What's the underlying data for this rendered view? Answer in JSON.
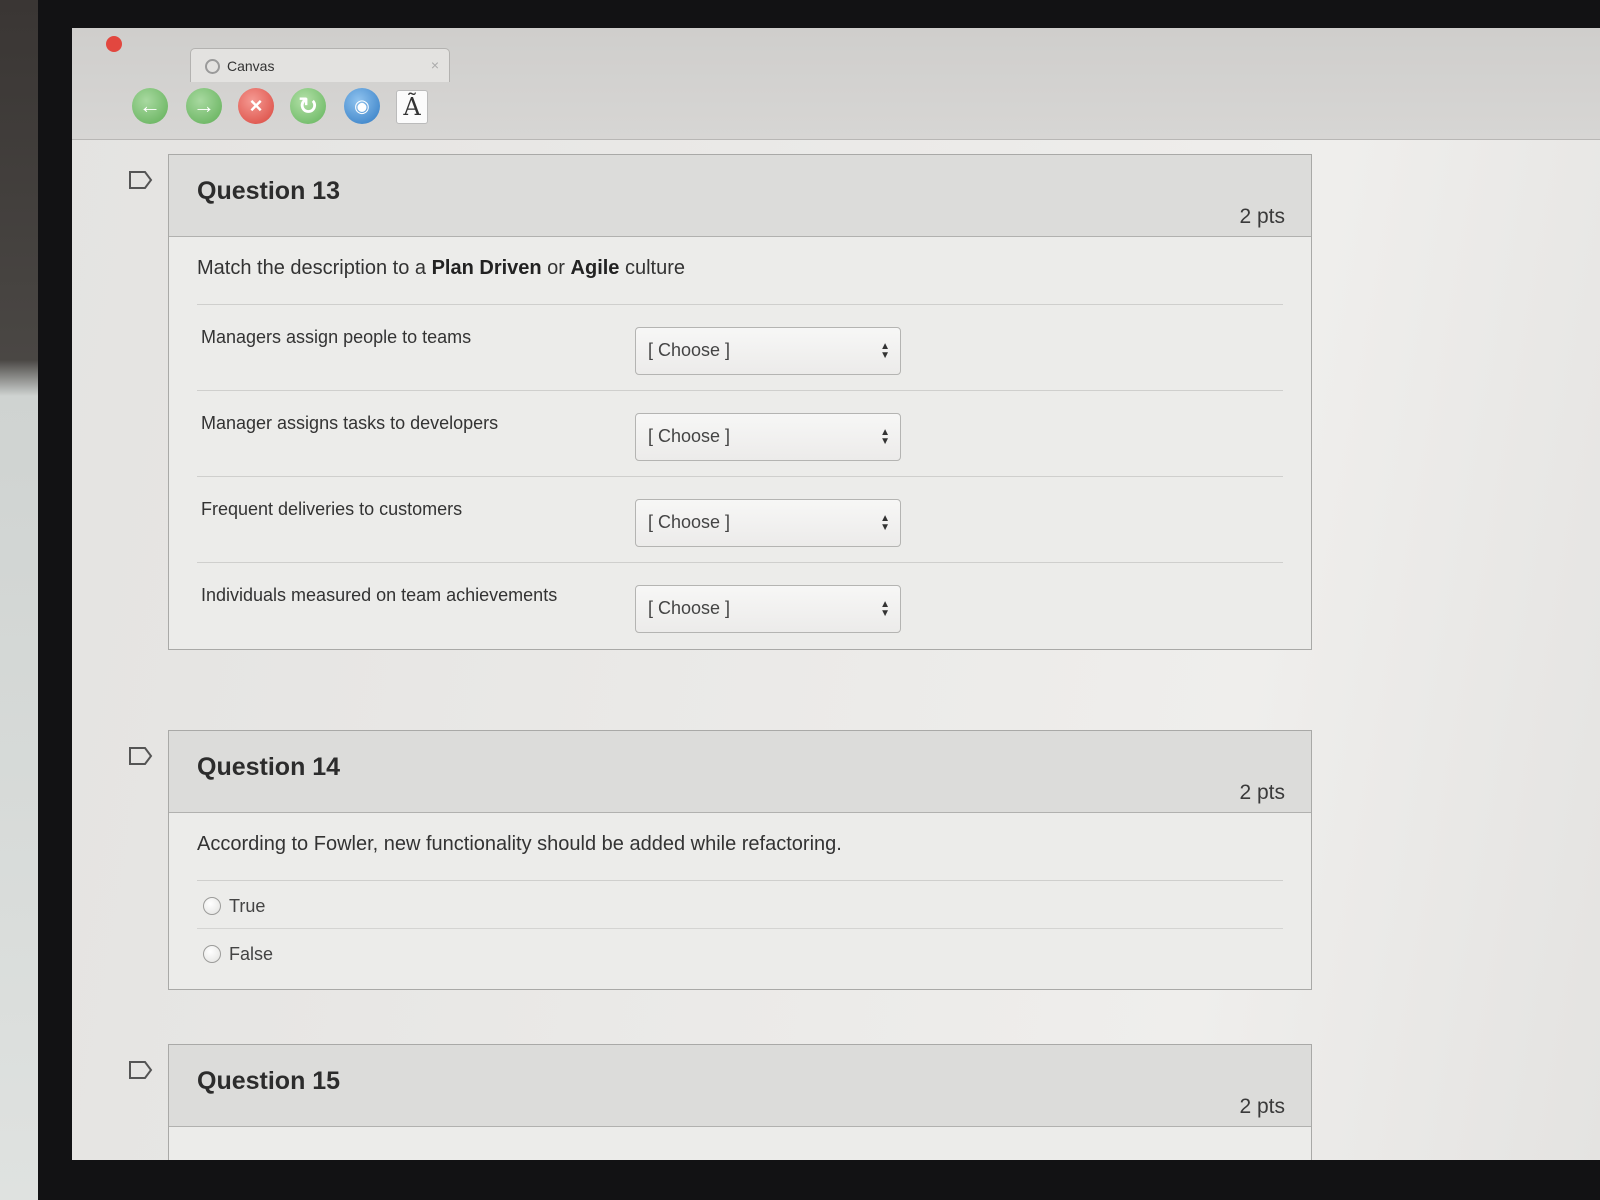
{
  "browser": {
    "tab_title": "Canvas",
    "tab_close": "×",
    "toolbar": {
      "back_icon": "←",
      "forward_icon": "→",
      "stop_icon": "×",
      "reload_icon": "↻",
      "globe_icon": "◉",
      "font_icon": "Ã"
    }
  },
  "questions": [
    {
      "title": "Question 13",
      "points": "2 pts",
      "prompt_parts": [
        "Match the description to a ",
        "Plan Driven",
        " or ",
        "Agile",
        " culture"
      ],
      "match_rows": [
        {
          "label": "Managers assign people to teams",
          "selected": "[ Choose ]"
        },
        {
          "label": "Manager assigns tasks to developers",
          "selected": "[ Choose ]"
        },
        {
          "label": "Frequent deliveries to customers",
          "selected": "[ Choose ]"
        },
        {
          "label": "Individuals measured on team achievements",
          "selected": "[ Choose ]"
        }
      ]
    },
    {
      "title": "Question 14",
      "points": "2 pts",
      "prompt": "According to Fowler, new functionality should be added while refactoring.",
      "options": [
        "True",
        "False"
      ]
    },
    {
      "title": "Question 15",
      "points": "2 pts"
    }
  ],
  "colors": {
    "close_button": "#e2473f",
    "nav_green": "#5fae56",
    "stop_red": "#d9463d",
    "globe_blue": "#2f79c2"
  }
}
